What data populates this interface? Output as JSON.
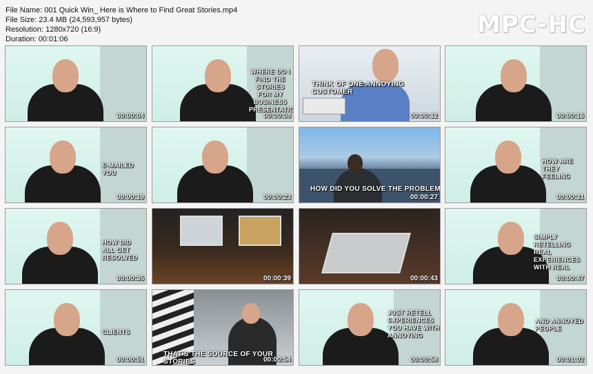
{
  "header": {
    "file_name": "File Name: 001 Quick Win_ Here is Where to Find Great Stories.mp4",
    "file_size": "File Size: 23.4 MB (24,593,957 bytes)",
    "resolution": "Resolution: 1280x720 (16:9)",
    "duration": "Duration: 00:01:06"
  },
  "logo": "MPC-HC",
  "thumbs": [
    {
      "time": "00:00:04",
      "caption": ""
    },
    {
      "time": "00:00:08",
      "caption": "WHERE DO I FIND THE STORIES FOR MY BUSINESS PRESENTATIONS"
    },
    {
      "time": "00:00:12",
      "caption": "THINK OF ONE ANNOYING CUSTOMER"
    },
    {
      "time": "00:00:16",
      "caption": ""
    },
    {
      "time": "00:00:19",
      "caption": "E-MAILED YOU"
    },
    {
      "time": "00:00:23",
      "caption": ""
    },
    {
      "time": "00:00:27",
      "caption": "HOW DID YOU SOLVE THE PROBLEM"
    },
    {
      "time": "00:00:31",
      "caption": "HOW ARE THEY FEELING"
    },
    {
      "time": "00:00:35",
      "caption": "HOW DID ALL GET RESOLVED"
    },
    {
      "time": "00:00:39",
      "caption": ""
    },
    {
      "time": "00:00:43",
      "caption": ""
    },
    {
      "time": "00:00:47",
      "caption": "SIMPLY RETELLING REAL EXPERIENCES WITH REAL"
    },
    {
      "time": "00:00:51",
      "caption": "CLIENTS"
    },
    {
      "time": "00:00:54",
      "caption": "THAT'S THE SOURCE OF YOUR STORIES"
    },
    {
      "time": "00:00:58",
      "caption": "JUST RETELL EXPERIENCES YOU HAVE WITH ANNOYING"
    },
    {
      "time": "00:01:02",
      "caption": "AND ANNOYED PEOPLE"
    }
  ]
}
